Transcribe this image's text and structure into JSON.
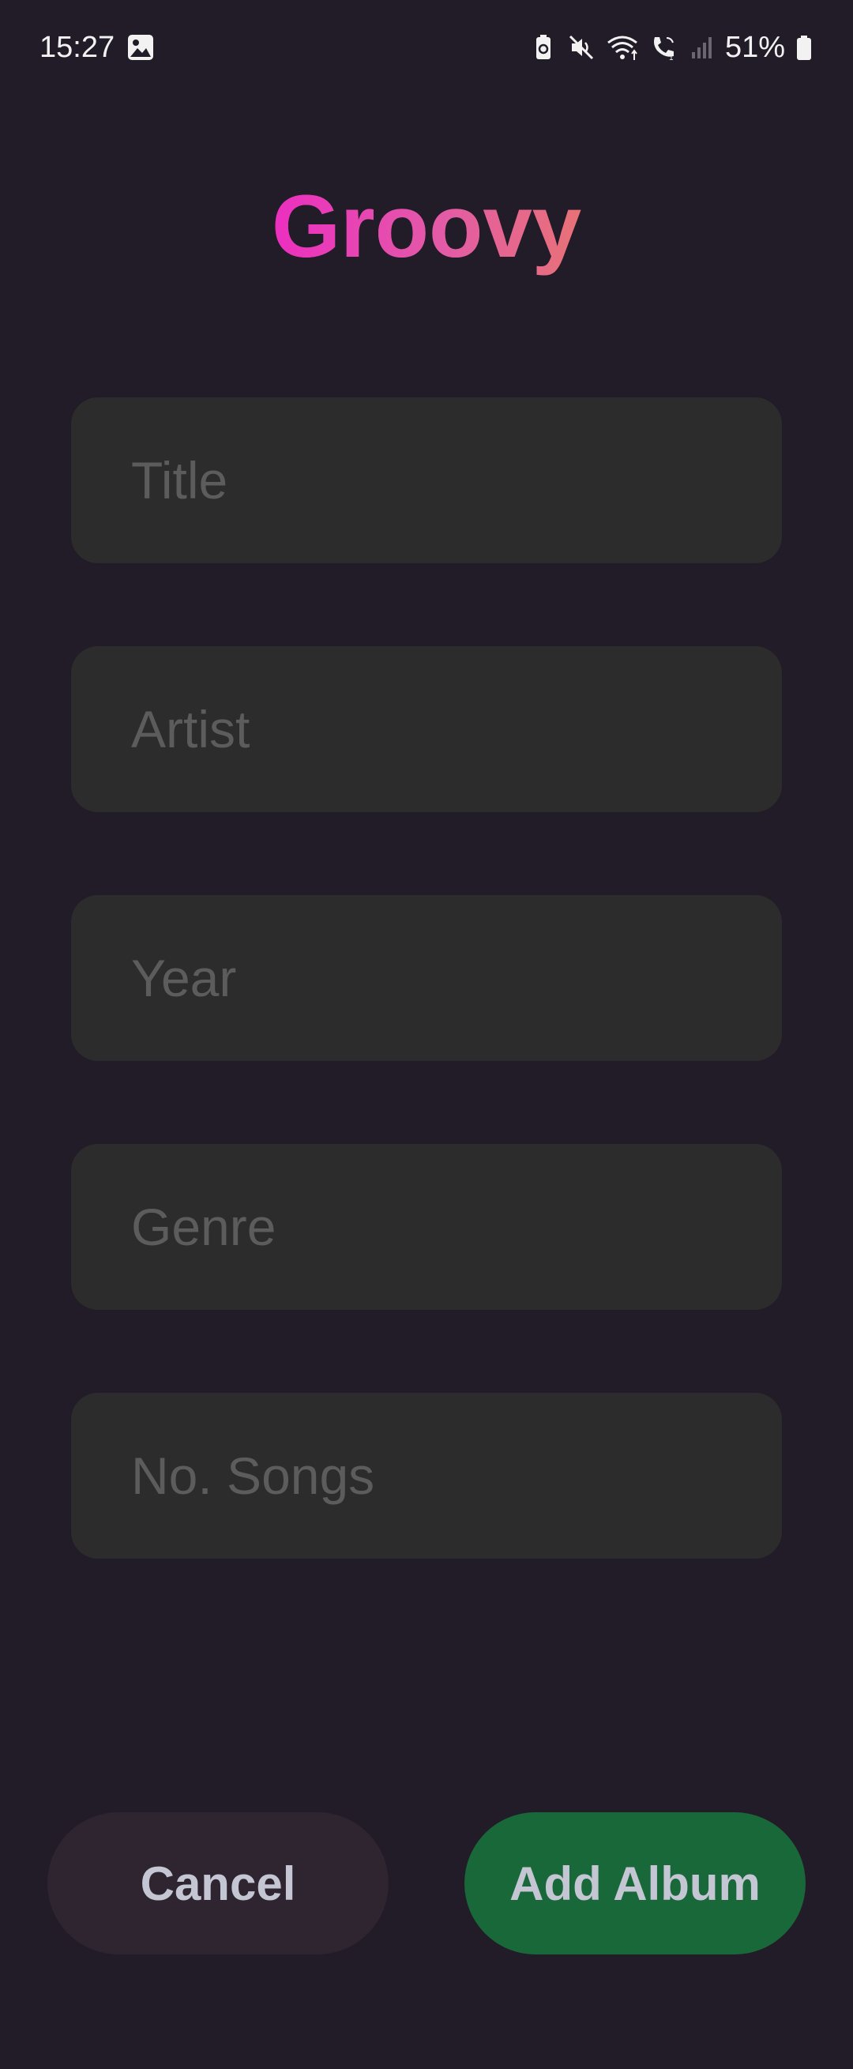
{
  "status_bar": {
    "time": "15:27",
    "battery_percent": "51%",
    "icons": [
      "gallery-icon",
      "battery-saver-icon",
      "mute-icon",
      "wifi-icon",
      "wifi-call-icon",
      "signal-icon",
      "battery-icon"
    ]
  },
  "app": {
    "title": "Groovy",
    "title_gradient": [
      "#ec2ec0",
      "#e87276"
    ]
  },
  "form": {
    "fields": [
      {
        "name": "title",
        "placeholder": "Title",
        "value": ""
      },
      {
        "name": "artist",
        "placeholder": "Artist",
        "value": ""
      },
      {
        "name": "year",
        "placeholder": "Year",
        "value": ""
      },
      {
        "name": "genre",
        "placeholder": "Genre",
        "value": ""
      },
      {
        "name": "no_songs",
        "placeholder": "No. Songs",
        "value": ""
      }
    ]
  },
  "actions": {
    "cancel_label": "Cancel",
    "add_label": "Add Album",
    "add_color": "#19683a",
    "cancel_color": "#2e2530"
  },
  "colors": {
    "background": "#221c29",
    "field_background": "#2c2c2c",
    "placeholder": "#5c5c5c",
    "button_text": "#c5c6d3"
  }
}
